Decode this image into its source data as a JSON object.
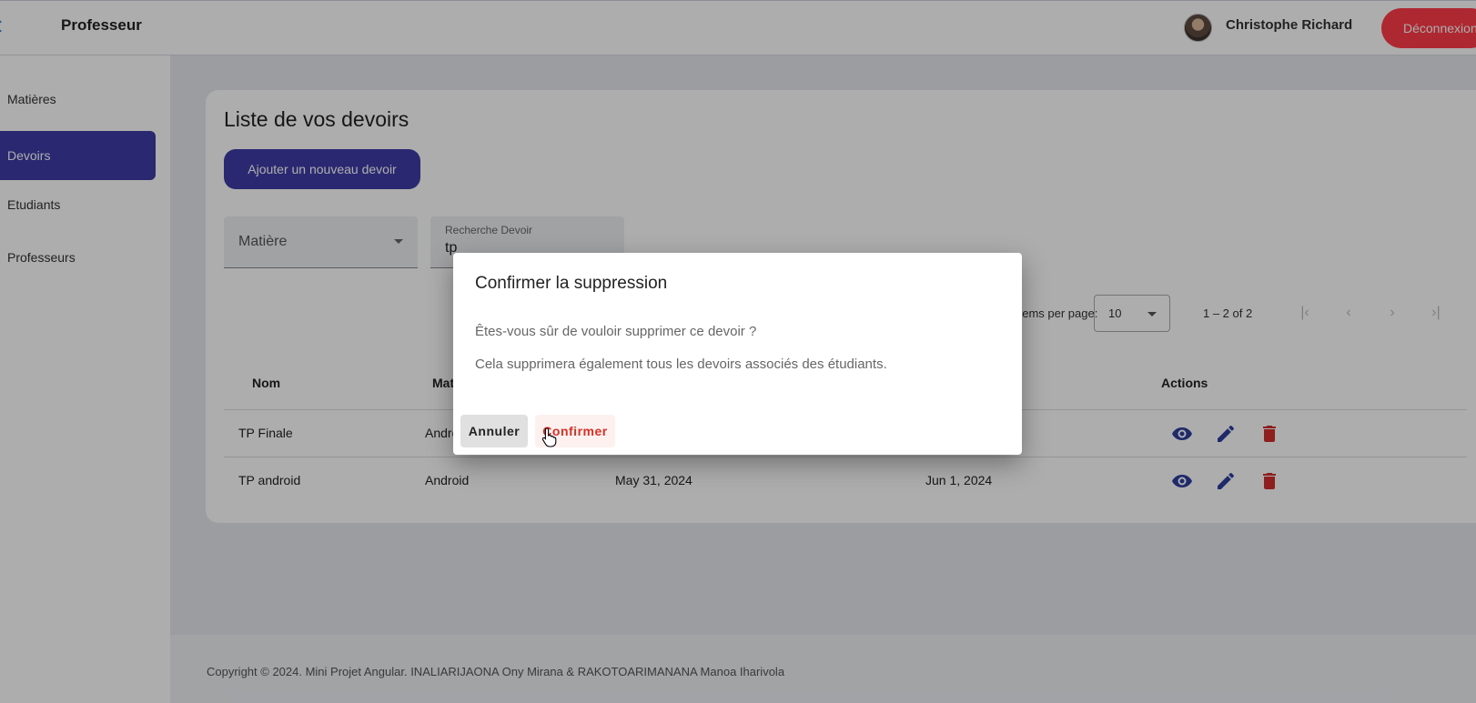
{
  "header": {
    "app_title": "Professeur",
    "user_name": "Christophe Richard",
    "logout_label": "Déconnexion"
  },
  "sidebar": {
    "items": [
      {
        "label": "Matières"
      },
      {
        "label": "Devoirs",
        "active": true
      },
      {
        "label": "Etudiants"
      },
      {
        "label": "Professeurs"
      }
    ]
  },
  "main": {
    "title": "Liste de vos devoirs",
    "add_button": "Ajouter un nouveau devoir",
    "filter_select_label": "Matière",
    "search_label": "Recherche Devoir",
    "search_value": "tp",
    "paginator": {
      "items_per_page_label": "Items per page:",
      "page_size": "10",
      "range": "1 – 2 of 2"
    },
    "table": {
      "headers": [
        "Nom",
        "Matière",
        "",
        "",
        "Actions"
      ],
      "rows": [
        [
          "TP Finale",
          "Android",
          "",
          ""
        ],
        [
          "TP android",
          "Android",
          "May 31, 2024",
          "Jun 1, 2024"
        ]
      ]
    }
  },
  "footer": {
    "text": "Copyright © 2024. Mini Projet Angular. INALIARIJAONA Ony Mirana & RAKOTOARIMANANA Manoa Iharivola"
  },
  "dialog": {
    "title": "Confirmer la suppression",
    "message_1": "Êtes-vous sûr de vouloir supprimer ce devoir ?",
    "message_2": "Cela supprimera également tous les devoirs associés des étudiants.",
    "cancel_label": "Annuler",
    "confirm_label": "Confirmer"
  },
  "colors": {
    "primary": "#3f3ba6",
    "danger": "#ff3b48",
    "icon_blue": "#2f3f9e",
    "icon_red": "#d32f2f"
  }
}
